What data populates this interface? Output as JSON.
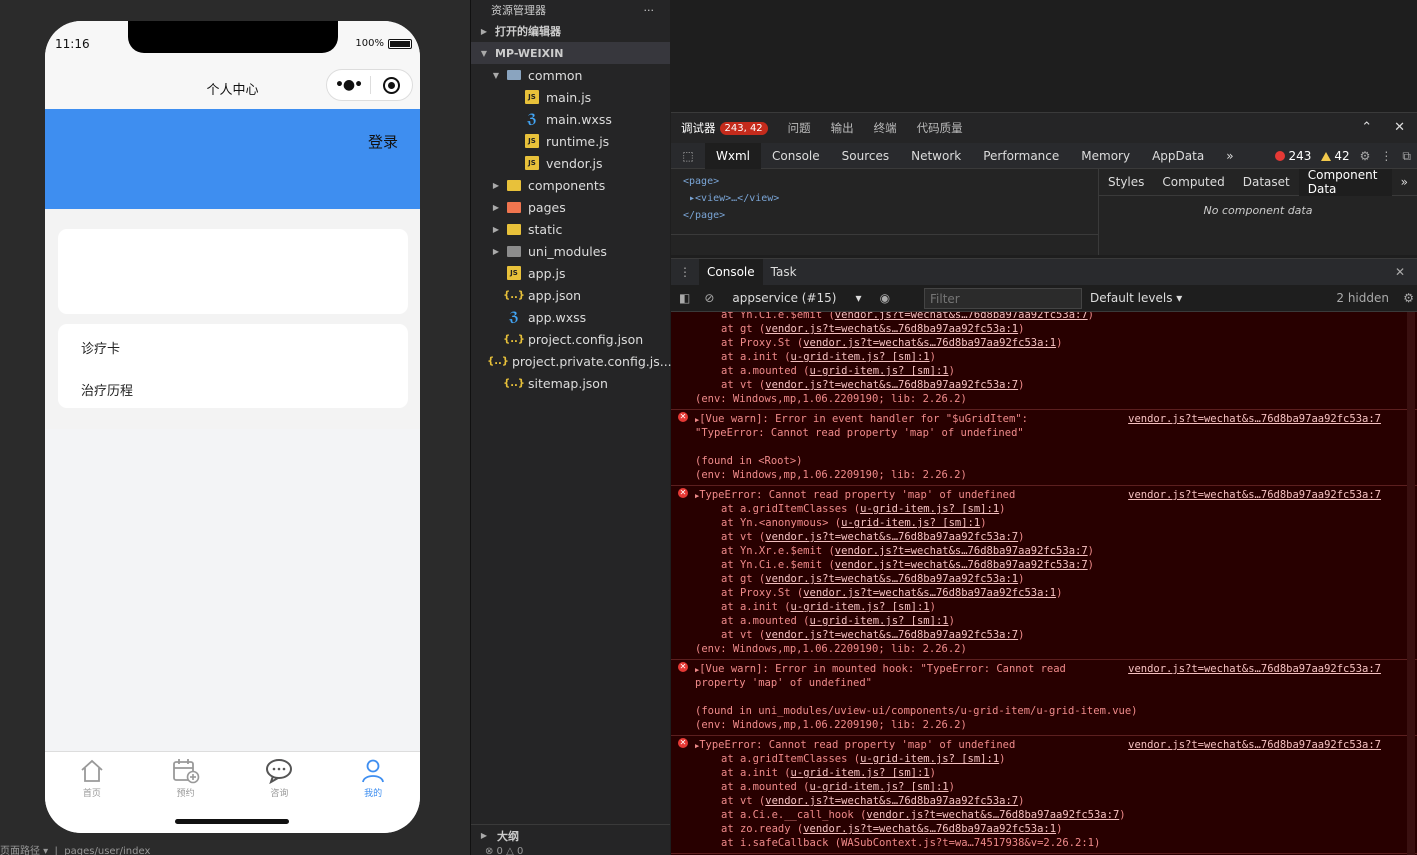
{
  "simulator": {
    "status_time": "11:16",
    "battery": "100%",
    "nav_title": "个人中心",
    "login": "登录",
    "menu_items": [
      "诊疗卡",
      "治疗历程"
    ],
    "tabs": [
      {
        "label": "首页",
        "icon": "home-icon"
      },
      {
        "label": "预约",
        "icon": "calendar-add-icon"
      },
      {
        "label": "咨询",
        "icon": "chat-icon"
      },
      {
        "label": "我的",
        "icon": "user-icon",
        "active": true
      }
    ],
    "footer_path_label": "页面路径",
    "footer_path": "pages/user/index"
  },
  "explorer": {
    "title": "资源管理器",
    "more": "···",
    "open_editors": "打开的编辑器",
    "project": "MP-WEIXIN",
    "tree": [
      {
        "name": "common",
        "type": "folder-open",
        "level": 1
      },
      {
        "name": "main.js",
        "type": "js",
        "level": 2
      },
      {
        "name": "main.wxss",
        "type": "css",
        "level": 2
      },
      {
        "name": "runtime.js",
        "type": "js",
        "level": 2
      },
      {
        "name": "vendor.js",
        "type": "js",
        "level": 2
      },
      {
        "name": "components",
        "type": "folder-comp",
        "level": 1
      },
      {
        "name": "pages",
        "type": "folder-pages",
        "level": 1
      },
      {
        "name": "static",
        "type": "folder-static",
        "level": 1
      },
      {
        "name": "uni_modules",
        "type": "folder",
        "level": 1
      },
      {
        "name": "app.js",
        "type": "js",
        "level": 1
      },
      {
        "name": "app.json",
        "type": "json",
        "level": 1
      },
      {
        "name": "app.wxss",
        "type": "css",
        "level": 1
      },
      {
        "name": "project.config.json",
        "type": "json",
        "level": 1
      },
      {
        "name": "project.private.config.js...",
        "type": "json",
        "level": 1
      },
      {
        "name": "sitemap.json",
        "type": "json",
        "level": 1
      }
    ],
    "outline": "大纲",
    "footer": "⊗ 0 △ 0"
  },
  "devtools": {
    "top_tabs": [
      {
        "label": "调试器",
        "badge": "243, 42",
        "active": true
      },
      {
        "label": "问题"
      },
      {
        "label": "输出"
      },
      {
        "label": "终端"
      },
      {
        "label": "代码质量"
      }
    ],
    "panel_tabs": [
      "Wxml",
      "Console",
      "Sources",
      "Network",
      "Performance",
      "Memory",
      "AppData"
    ],
    "error_count": "243",
    "warning_count": "42",
    "wxml": [
      "<page>",
      "<view>…</view>",
      "</page>"
    ],
    "side_tabs": [
      "Styles",
      "Computed",
      "Dataset",
      "Component Data"
    ],
    "no_component_data": "No component data",
    "console_tabs": [
      "Console",
      "Task"
    ],
    "context": "appservice (#15)",
    "filter_placeholder": "Filter",
    "levels": "Default levels",
    "hidden": "2 hidden",
    "entries": [
      {
        "header": null,
        "source": "",
        "lines": [
          {
            "i": true,
            "pre": "at Yn.Ci.e.$emit (",
            "link": "vendor.js?t=wechat&s…76d8ba97aa92fc53a:7",
            "post": ")"
          },
          {
            "i": true,
            "pre": "at gt (",
            "link": "vendor.js?t=wechat&s…76d8ba97aa92fc53a:1",
            "post": ")"
          },
          {
            "i": true,
            "pre": "at Proxy.St (",
            "link": "vendor.js?t=wechat&s…76d8ba97aa92fc53a:1",
            "post": ")"
          },
          {
            "i": true,
            "pre": "at a.init (",
            "link": "u-grid-item.js? [sm]:1",
            "post": ")"
          },
          {
            "i": true,
            "pre": "at a.mounted (",
            "link": "u-grid-item.js? [sm]:1",
            "post": ")"
          },
          {
            "i": true,
            "pre": "at vt (",
            "link": "vendor.js?t=wechat&s…76d8ba97aa92fc53a:7",
            "post": ")"
          },
          {
            "i": false,
            "pre": "(env: Windows,mp,1.06.2209190; lib: 2.26.2)",
            "link": "",
            "post": ""
          }
        ]
      },
      {
        "header": "[Vue warn]: Error in event handler for \"$uGridItem\":",
        "source": "vendor.js?t=wechat&s…76d8ba97aa92fc53a:7",
        "lines": [
          {
            "i": false,
            "pre": "\"TypeError: Cannot read property 'map' of undefined\"",
            "link": "",
            "post": ""
          },
          {
            "i": false,
            "pre": " ",
            "link": "",
            "post": ""
          },
          {
            "i": false,
            "pre": "(found in <Root>)",
            "link": "",
            "post": ""
          },
          {
            "i": false,
            "pre": "(env: Windows,mp,1.06.2209190; lib: 2.26.2)",
            "link": "",
            "post": ""
          }
        ]
      },
      {
        "header": "TypeError: Cannot read property 'map' of undefined",
        "source": "vendor.js?t=wechat&s…76d8ba97aa92fc53a:7",
        "lines": [
          {
            "i": true,
            "pre": "at a.gridItemClasses (",
            "link": "u-grid-item.js? [sm]:1",
            "post": ")"
          },
          {
            "i": true,
            "pre": "at Yn.<anonymous> (",
            "link": "u-grid-item.js? [sm]:1",
            "post": ")"
          },
          {
            "i": true,
            "pre": "at vt (",
            "link": "vendor.js?t=wechat&s…76d8ba97aa92fc53a:7",
            "post": ")"
          },
          {
            "i": true,
            "pre": "at Yn.Xr.e.$emit (",
            "link": "vendor.js?t=wechat&s…76d8ba97aa92fc53a:7",
            "post": ")"
          },
          {
            "i": true,
            "pre": "at Yn.Ci.e.$emit (",
            "link": "vendor.js?t=wechat&s…76d8ba97aa92fc53a:7",
            "post": ")"
          },
          {
            "i": true,
            "pre": "at gt (",
            "link": "vendor.js?t=wechat&s…76d8ba97aa92fc53a:1",
            "post": ")"
          },
          {
            "i": true,
            "pre": "at Proxy.St (",
            "link": "vendor.js?t=wechat&s…76d8ba97aa92fc53a:1",
            "post": ")"
          },
          {
            "i": true,
            "pre": "at a.init (",
            "link": "u-grid-item.js? [sm]:1",
            "post": ")"
          },
          {
            "i": true,
            "pre": "at a.mounted (",
            "link": "u-grid-item.js? [sm]:1",
            "post": ")"
          },
          {
            "i": true,
            "pre": "at vt (",
            "link": "vendor.js?t=wechat&s…76d8ba97aa92fc53a:7",
            "post": ")"
          },
          {
            "i": false,
            "pre": "(env: Windows,mp,1.06.2209190; lib: 2.26.2)",
            "link": "",
            "post": ""
          }
        ]
      },
      {
        "header": "[Vue warn]: Error in mounted hook: \"TypeError: Cannot read",
        "source": "vendor.js?t=wechat&s…76d8ba97aa92fc53a:7",
        "lines": [
          {
            "i": false,
            "pre": "property 'map' of undefined\"",
            "link": "",
            "post": ""
          },
          {
            "i": false,
            "pre": " ",
            "link": "",
            "post": ""
          },
          {
            "i": false,
            "pre": "(found in uni_modules/uview-ui/components/u-grid-item/u-grid-item.vue)",
            "link": "",
            "post": ""
          },
          {
            "i": false,
            "pre": "(env: Windows,mp,1.06.2209190; lib: 2.26.2)",
            "link": "",
            "post": ""
          }
        ]
      },
      {
        "header": "TypeError: Cannot read property 'map' of undefined",
        "source": "vendor.js?t=wechat&s…76d8ba97aa92fc53a:7",
        "lines": [
          {
            "i": true,
            "pre": "at a.gridItemClasses (",
            "link": "u-grid-item.js? [sm]:1",
            "post": ")"
          },
          {
            "i": true,
            "pre": "at a.init (",
            "link": "u-grid-item.js? [sm]:1",
            "post": ")"
          },
          {
            "i": true,
            "pre": "at a.mounted (",
            "link": "u-grid-item.js? [sm]:1",
            "post": ")"
          },
          {
            "i": true,
            "pre": "at vt (",
            "link": "vendor.js?t=wechat&s…76d8ba97aa92fc53a:7",
            "post": ")"
          },
          {
            "i": true,
            "pre": "at a.Ci.e.__call_hook (",
            "link": "vendor.js?t=wechat&s…76d8ba97aa92fc53a:7",
            "post": ")"
          },
          {
            "i": true,
            "pre": "at zo.ready (",
            "link": "vendor.js?t=wechat&s…76d8ba97aa92fc53a:1",
            "post": ")"
          },
          {
            "i": true,
            "pre": "at i.safeCallback (WASubContext.js?t=wa…74517938&v=2.26.2:1)",
            "link": "",
            "post": ""
          }
        ]
      }
    ]
  }
}
